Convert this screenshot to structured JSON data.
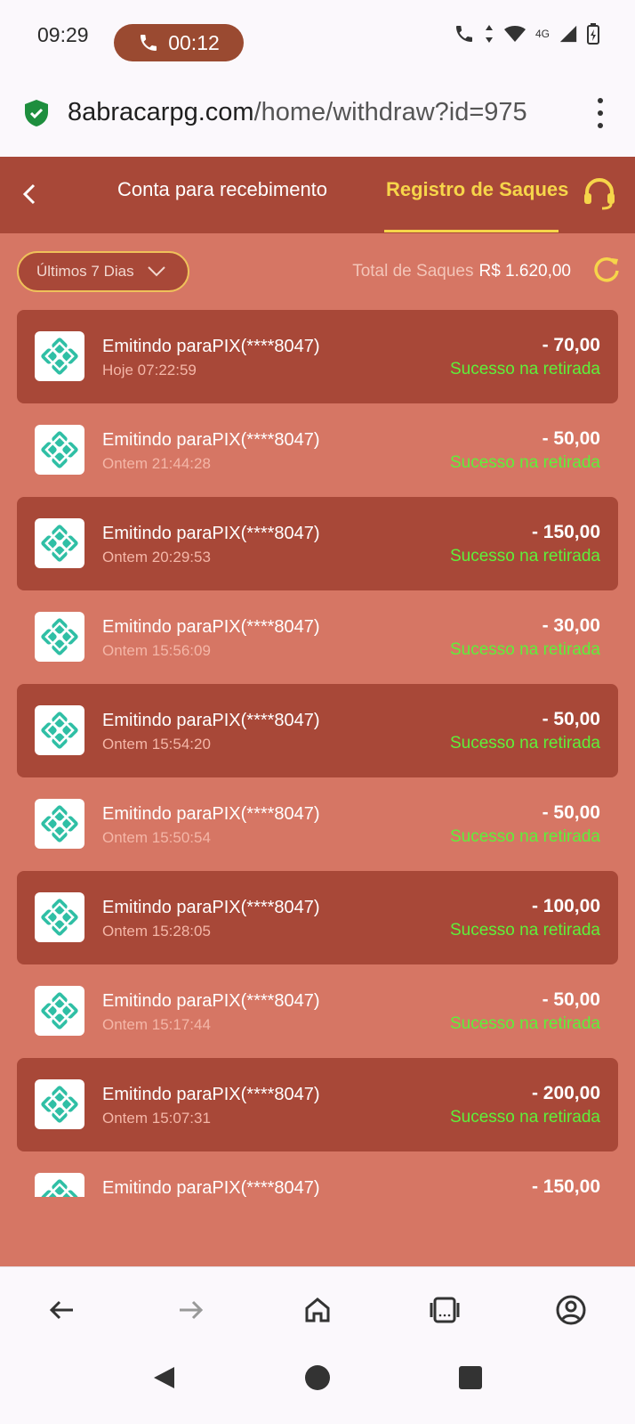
{
  "status_bar": {
    "time": "09:29",
    "call_duration": "00:12",
    "network": "4G"
  },
  "browser": {
    "url_domain": "8abracarpg.com",
    "url_path": "/home/withdraw?id=975"
  },
  "header": {
    "tab_account": "Conta para recebimento",
    "tab_records": "Registro de Saques",
    "accent_color": "#f6d54a"
  },
  "filter": {
    "label": "Últimos 7 Dias"
  },
  "total": {
    "label": "Total de Saques",
    "amount": "R$ 1.620,00"
  },
  "withdrawals": [
    {
      "title": "Emitindo paraPIX(****8047)",
      "time": "Hoje 07:22:59",
      "amount": "- 70,00",
      "status": "Sucesso na retirada"
    },
    {
      "title": "Emitindo paraPIX(****8047)",
      "time": "Ontem 21:44:28",
      "amount": "- 50,00",
      "status": "Sucesso na retirada"
    },
    {
      "title": "Emitindo paraPIX(****8047)",
      "time": "Ontem 20:29:53",
      "amount": "- 150,00",
      "status": "Sucesso na retirada"
    },
    {
      "title": "Emitindo paraPIX(****8047)",
      "time": "Ontem 15:56:09",
      "amount": "- 30,00",
      "status": "Sucesso na retirada"
    },
    {
      "title": "Emitindo paraPIX(****8047)",
      "time": "Ontem 15:54:20",
      "amount": "- 50,00",
      "status": "Sucesso na retirada"
    },
    {
      "title": "Emitindo paraPIX(****8047)",
      "time": "Ontem 15:50:54",
      "amount": "- 50,00",
      "status": "Sucesso na retirada"
    },
    {
      "title": "Emitindo paraPIX(****8047)",
      "time": "Ontem 15:28:05",
      "amount": "- 100,00",
      "status": "Sucesso na retirada"
    },
    {
      "title": "Emitindo paraPIX(****8047)",
      "time": "Ontem 15:17:44",
      "amount": "- 50,00",
      "status": "Sucesso na retirada"
    },
    {
      "title": "Emitindo paraPIX(****8047)",
      "time": "Ontem 15:07:31",
      "amount": "- 200,00",
      "status": "Sucesso na retirada"
    },
    {
      "title": "Emitindo paraPIX(****8047)",
      "time": "",
      "amount": "- 150,00",
      "status": ""
    }
  ],
  "colors": {
    "header_bg": "#a84838",
    "page_bg": "#d67664",
    "success": "#5ef03a",
    "pix_logo": "#2fbfa5"
  },
  "icons": {
    "back": "chevron-left-icon",
    "support": "headset-icon",
    "refresh": "refresh-icon",
    "pix": "pix-logo-icon"
  }
}
